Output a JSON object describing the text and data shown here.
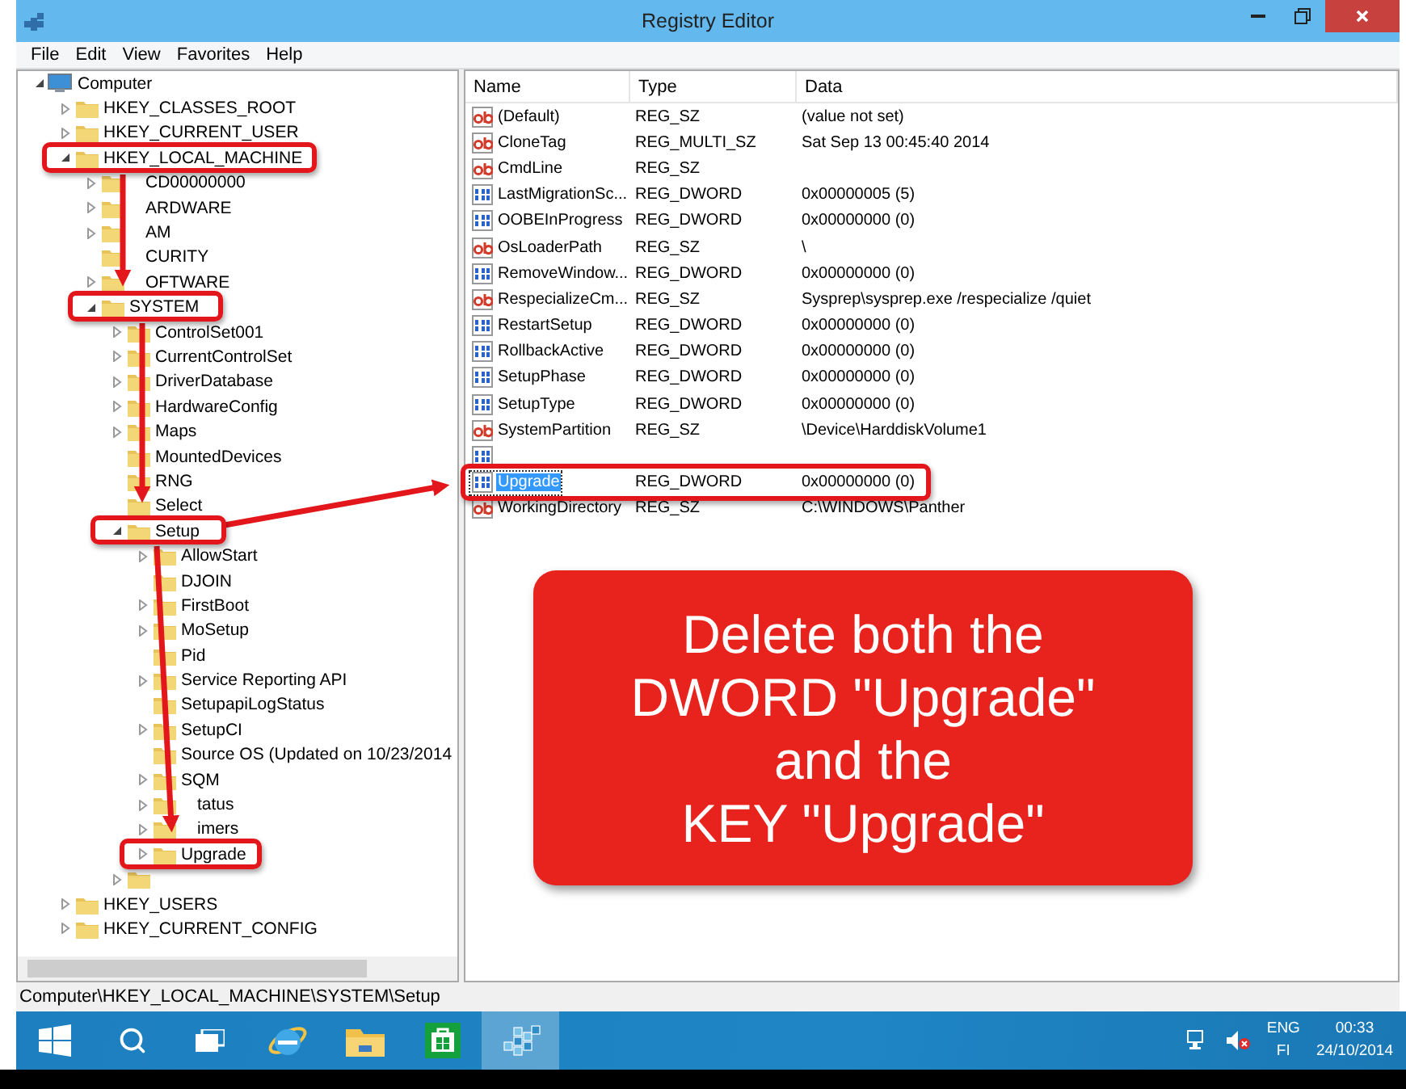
{
  "window": {
    "title": "Registry Editor"
  },
  "menu": [
    "File",
    "Edit",
    "View",
    "Favorites",
    "Help"
  ],
  "tree": [
    {
      "label": "Computer",
      "kind": "computer",
      "expanded": true,
      "children": [
        {
          "label": "HKEY_CLASSES_ROOT",
          "expanded": false
        },
        {
          "label": "HKEY_CURRENT_USER",
          "expanded": false
        },
        {
          "label": "HKEY_LOCAL_MACHINE",
          "expanded": true,
          "children": [
            {
              "label": "CD00000000",
              "expanded": false,
              "covered": true
            },
            {
              "label": "ARDWARE",
              "expanded": false,
              "covered": true
            },
            {
              "label": "AM",
              "expanded": false,
              "covered": true
            },
            {
              "label": "CURITY",
              "covered": true
            },
            {
              "label": "OFTWARE",
              "expanded": false,
              "covered": true
            },
            {
              "label": "SYSTEM",
              "expanded": true,
              "children": [
                {
                  "label": "ControlSet001",
                  "expanded": false
                },
                {
                  "label": "CurrentControlSet",
                  "expanded": false
                },
                {
                  "label": "DriverDatabase",
                  "expanded": false
                },
                {
                  "label": "HardwareConfig",
                  "expanded": false
                },
                {
                  "label": "Maps",
                  "expanded": false
                },
                {
                  "label": "MountedDevices"
                },
                {
                  "label": "RNG"
                },
                {
                  "label": "Select"
                },
                {
                  "label": "Setup",
                  "expanded": true,
                  "children": [
                    {
                      "label": "AllowStart",
                      "expanded": false
                    },
                    {
                      "label": "DJOIN"
                    },
                    {
                      "label": "FirstBoot",
                      "expanded": false
                    },
                    {
                      "label": "MoSetup",
                      "expanded": false
                    },
                    {
                      "label": "Pid"
                    },
                    {
                      "label": "Service Reporting API",
                      "expanded": false
                    },
                    {
                      "label": "SetupapiLogStatus"
                    },
                    {
                      "label": "SetupCI",
                      "expanded": false
                    },
                    {
                      "label": "Source OS (Updated on 10/23/2014"
                    },
                    {
                      "label": "SQM",
                      "expanded": false
                    },
                    {
                      "label": "tatus",
                      "expanded": false,
                      "covered": true
                    },
                    {
                      "label": "imers",
                      "expanded": false,
                      "covered": true
                    },
                    {
                      "label": "Upgrade",
                      "expanded": false
                    }
                  ]
                },
                {
                  "expanded": false
                }
              ]
            }
          ]
        },
        {
          "label": "HKEY_USERS",
          "expanded": false
        },
        {
          "label": "HKEY_CURRENT_CONFIG",
          "expanded": false
        }
      ]
    }
  ],
  "list": {
    "columns": [
      "Name",
      "Type",
      "Data"
    ],
    "rows": [
      {
        "kind": "string",
        "name": "(Default)",
        "type": "REG_SZ",
        "data": "(value not set)",
        "selected": false
      },
      {
        "kind": "string",
        "name": "CloneTag",
        "type": "REG_MULTI_SZ",
        "data": "Sat Sep 13 00:45:40 2014",
        "selected": false
      },
      {
        "kind": "string",
        "name": "CmdLine",
        "type": "REG_SZ",
        "selected": false
      },
      {
        "kind": "dword",
        "name": "LastMigrationSc...",
        "type": "REG_DWORD",
        "data": "0x00000005 (5)",
        "selected": false
      },
      {
        "kind": "dword",
        "name": "OOBEInProgress",
        "type": "REG_DWORD",
        "data": "0x00000000 (0)",
        "selected": false
      },
      {
        "kind": "string",
        "name": "OsLoaderPath",
        "type": "REG_SZ",
        "data": "\\",
        "selected": false
      },
      {
        "kind": "dword",
        "name": "RemoveWindow...",
        "type": "REG_DWORD",
        "data": "0x00000000 (0)",
        "selected": false
      },
      {
        "kind": "string",
        "name": "RespecializeCm...",
        "type": "REG_SZ",
        "data": "Sysprep\\sysprep.exe /respecialize /quiet",
        "selected": false
      },
      {
        "kind": "dword",
        "name": "RestartSetup",
        "type": "REG_DWORD",
        "data": "0x00000000 (0)",
        "selected": false
      },
      {
        "kind": "dword",
        "name": "RollbackActive",
        "type": "REG_DWORD",
        "data": "0x00000000 (0)",
        "selected": false
      },
      {
        "kind": "dword",
        "name": "SetupPhase",
        "type": "REG_DWORD",
        "data": "0x00000000 (0)",
        "selected": false
      },
      {
        "kind": "dword",
        "name": "SetupType",
        "type": "REG_DWORD",
        "data": "0x00000000 (0)",
        "selected": false
      },
      {
        "kind": "string",
        "name": "SystemPartition",
        "type": "REG_SZ",
        "data": "\\Device\\HarddiskVolume1",
        "selected": false
      },
      {
        "kind": "dword",
        "selected": false
      },
      {
        "kind": "dword",
        "name": "Upgrade",
        "type": "REG_DWORD",
        "data": "0x00000000 (0)",
        "selected": true
      },
      {
        "kind": "string",
        "name": "WorkingDirectory",
        "type": "REG_SZ",
        "data": "C:\\WINDOWS\\Panther",
        "selected": false
      }
    ]
  },
  "status_bar": "Computer\\HKEY_LOCAL_MACHINE\\SYSTEM\\Setup",
  "callout": [
    "Delete both the",
    "DWORD \"Upgrade\"",
    "and the",
    "KEY \"Upgrade\""
  ],
  "taskbar": {
    "apps": [
      {
        "kind": "search",
        "selected": false
      },
      {
        "kind": "taskview",
        "selected": false
      },
      {
        "kind": "browser",
        "selected": false
      },
      {
        "kind": "folder",
        "selected": false
      },
      {
        "kind": "store",
        "selected": false
      },
      {
        "kind": "regedit",
        "selected": true
      }
    ],
    "language": [
      "ENG",
      "FI"
    ],
    "time": "00:33",
    "date": "24/10/2014"
  }
}
